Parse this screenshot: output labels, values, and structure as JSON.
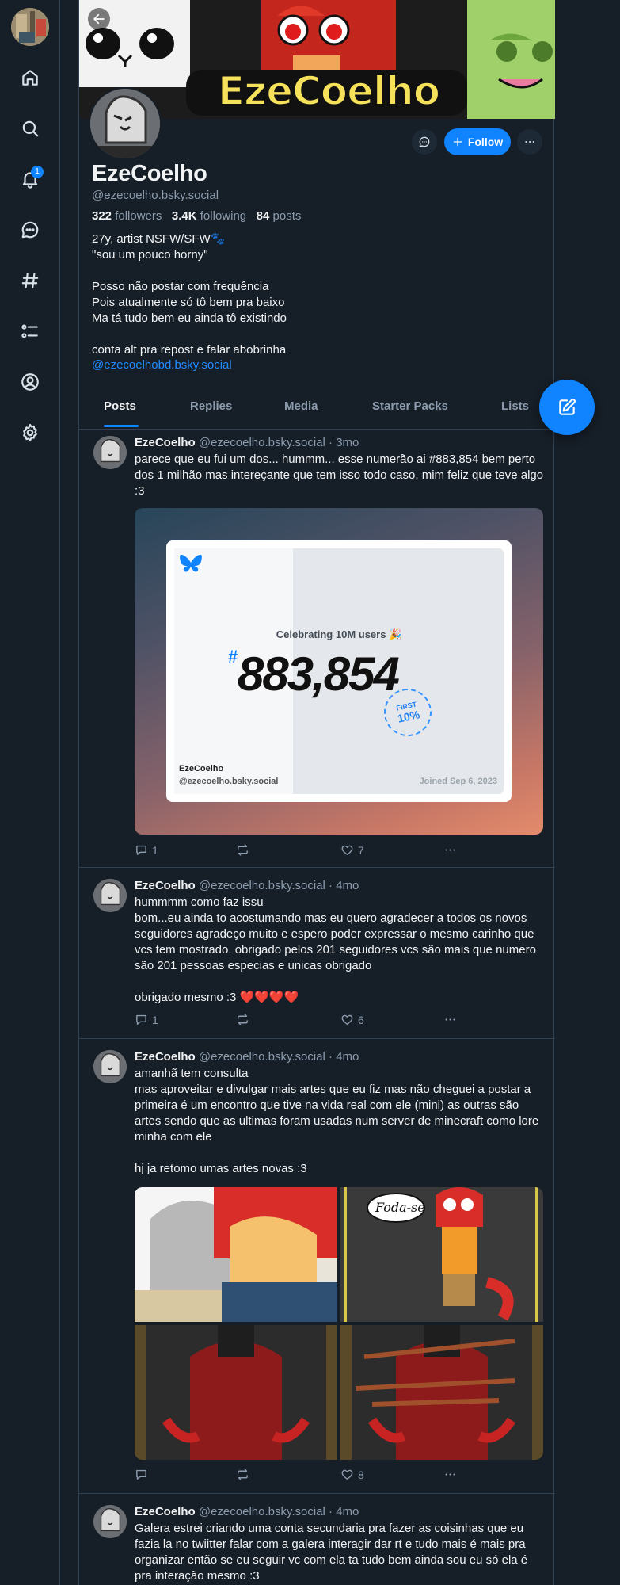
{
  "nav": {
    "items": [
      "home",
      "search",
      "notifications",
      "chat",
      "feeds",
      "lists",
      "profile",
      "settings"
    ],
    "notification_count": "1"
  },
  "banner": {
    "title": "EzeCoelho"
  },
  "profile": {
    "display_name": "EzeCoelho",
    "handle": "@ezecoelho.bsky.social",
    "followers_count": "322",
    "followers_label": "followers",
    "following_count": "3.4K",
    "following_label": "following",
    "posts_count": "84",
    "posts_label": "posts",
    "bio": "27y, artist NSFW/SFW🐾\n\"sou um pouco horny\"\n\nPosso não postar com frequência\nPois atualmente só tô bem pra baixo\nMa tá tudo bem eu ainda tô existindo\n\nconta alt pra repost e falar abobrinha",
    "bio_link": "@ezecoelhobd.bsky.social",
    "follow_label": "Follow"
  },
  "tabs": [
    "Posts",
    "Replies",
    "Media",
    "Starter Packs",
    "Lists"
  ],
  "posts": [
    {
      "author": "EzeCoelho",
      "meta": "@ezecoelho.bsky.social · 3mo",
      "text": "parece que eu fui um dos... hummm... esse numerão ai #883,854 bem perto dos 1 milhão mas intereçante que tem isso todo caso, mim feliz que teve algo :3",
      "replies": "1",
      "reposts": "",
      "likes": "7",
      "card": {
        "celebrating": "Celebrating 10M users 🎉",
        "hash": "#",
        "number": "883,854",
        "name": "EzeCoelho",
        "handle": "@ezecoelho.bsky.social",
        "joined": "Joined Sep 6, 2023",
        "seal_top": "FIRST",
        "seal_main": "10%"
      }
    },
    {
      "author": "EzeCoelho",
      "meta": "@ezecoelho.bsky.social · 4mo",
      "text": "hummmm como faz issu\nbom...eu ainda to acostumando mas eu quero agradecer a todos os novos seguidores agradeço muito e espero poder expressar o mesmo carinho que vcs tem mostrado. obrigado pelos 201 seguidores vcs são mais que numero são 201 pessoas especias e unicas obrigado\n\nobrigado mesmo :3 ❤️❤️❤️❤️",
      "replies": "1",
      "reposts": "",
      "likes": "6"
    },
    {
      "author": "EzeCoelho",
      "meta": "@ezecoelho.bsky.social · 4mo",
      "text": "amanhã tem consulta\nmas aproveitar e divulgar mais artes que eu fiz mas não cheguei a postar a primeira é um encontro que tive na vida real com ele (mini) as outras são artes sendo que as ultimas foram usadas num server de minecraft como lore minha com ele\n\nhj ja retomo umas artes novas :3",
      "replies": "",
      "reposts": "",
      "likes": "8",
      "speech": "Foda-se"
    },
    {
      "author": "EzeCoelho",
      "meta": "@ezecoelho.bsky.social · 4mo",
      "text": "Galera estrei criando uma conta secundaria pra fazer as coisinhas que eu fazia la no twiitter falar com a galera interagir dar rt e tudo mais é mais pra organizar então se eu seguir vc com ela ta tudo bem ainda sou eu só ela é pra interação mesmo :3"
    }
  ]
}
